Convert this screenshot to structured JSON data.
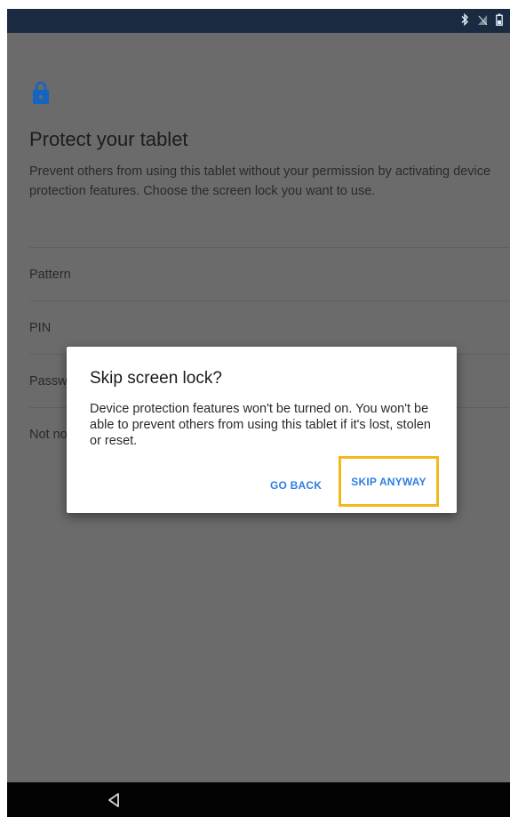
{
  "status_bar": {
    "icons": [
      "bluetooth-icon",
      "no-signal-icon",
      "battery-icon"
    ]
  },
  "screen": {
    "title": "Protect your tablet",
    "description": "Prevent others from using this tablet without your permission by activating device protection features. Choose the screen lock you want to use.",
    "options": [
      {
        "label": "Pattern"
      },
      {
        "label": "PIN"
      },
      {
        "label": "Password"
      },
      {
        "label": "Not now"
      }
    ]
  },
  "dialog": {
    "title": "Skip screen lock?",
    "body": "Device protection features won't be turned on. You won't be able to prevent others from using this tablet if it's lost, stolen or reset.",
    "go_back_label": "GO BACK",
    "skip_anyway_label": "SKIP ANYWAY"
  },
  "nav_bar": {
    "icons": [
      "back-triangle-icon"
    ]
  },
  "colors": {
    "accent": "#2d7ee3",
    "highlight": "#f2b81c",
    "scrim": "#6b6b6b",
    "status_bar": "#1a2a40",
    "nav_bar": "#030303"
  }
}
